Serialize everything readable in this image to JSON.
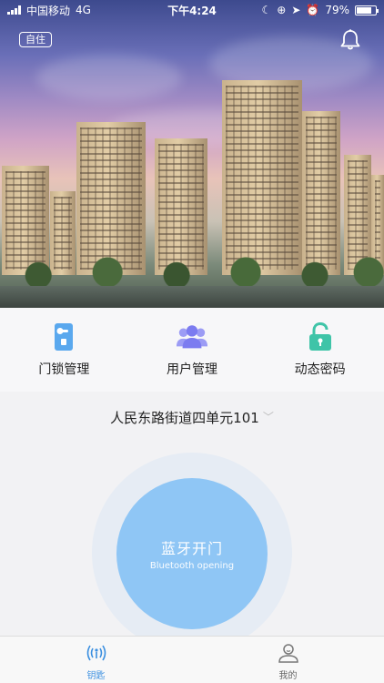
{
  "status_bar": {
    "carrier": "中国移动",
    "network": "4G",
    "time": "下午4:24",
    "battery": "79%",
    "battery_level": 0.79
  },
  "header": {
    "residence_tag": "自住"
  },
  "features": [
    {
      "label": "门锁管理",
      "icon": "door-lock-icon"
    },
    {
      "label": "用户管理",
      "icon": "users-icon"
    },
    {
      "label": "动态密码",
      "icon": "padlock-icon"
    }
  ],
  "address": {
    "text": "人民东路街道四单元101",
    "chevron": "chevron-down-icon"
  },
  "bluetooth_button": {
    "label_zh": "蓝牙开门",
    "label_en": "Bluetooth opening"
  },
  "tabs": [
    {
      "label": "钥匙",
      "icon": "key-signal-icon",
      "active": true
    },
    {
      "label": "我的",
      "icon": "profile-icon",
      "active": false
    }
  ],
  "colors": {
    "accent": "#3a8fe0",
    "bt_button": "#8fc6f5",
    "door_icon": "#5aa8ee",
    "users_icon": "#7c7cf0",
    "padlock_icon": "#3fc4a8"
  }
}
